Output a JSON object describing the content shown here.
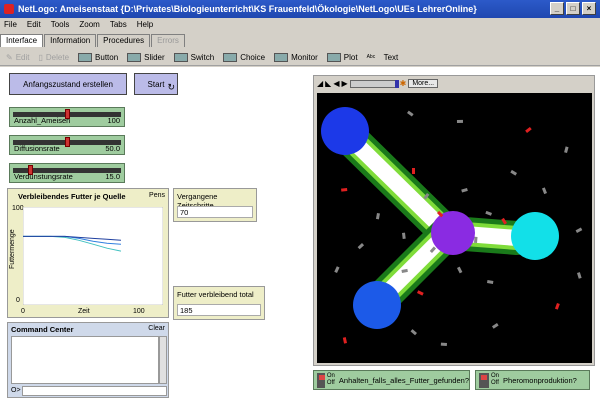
{
  "window": {
    "title": "NetLogo: Ameisenstaat {D:\\Privates\\Biologieunterricht\\KS Frauenfeld\\Ökologie\\NetLogo\\UEs LehrerOnline}"
  },
  "menu": [
    "File",
    "Edit",
    "Tools",
    "Zoom",
    "Tabs",
    "Help"
  ],
  "tabs": [
    "Interface",
    "Information",
    "Procedures",
    "Errors"
  ],
  "toolbar": {
    "edit": "Edit",
    "delete": "Delete",
    "button": "Button",
    "slider": "Slider",
    "switch": "Switch",
    "choice": "Choice",
    "monitor": "Monitor",
    "plot": "Plot",
    "text": "Text",
    "plot_icon": "Plot",
    "text_icon": "Abc def ghi jkl"
  },
  "buttons": {
    "setup": "Anfangszustand erstellen",
    "go": "Start"
  },
  "sliders": [
    {
      "label": "Anzahl_Ameisen",
      "value": "100",
      "fraction": 0.5
    },
    {
      "label": "Diffusionsrate",
      "value": "50.0",
      "fraction": 0.5
    },
    {
      "label": "Verdunstungsrate",
      "value": "15.0",
      "fraction": 0.15
    }
  ],
  "plot": {
    "title": "Verbleibendes Futter je Quelle",
    "pens": "Pens",
    "ylabel": "Futtermenge",
    "xlabel": "Zeit",
    "ymax": "100",
    "ymin": "0",
    "xmin": "0",
    "xmax": "100"
  },
  "monitors": [
    {
      "label": "Vergangene Zeitschritte",
      "value": "70"
    },
    {
      "label": "Futter verbleibend total",
      "value": "185"
    }
  ],
  "command_center": {
    "title": "Command Center",
    "clear": "Clear",
    "prompt": "O>"
  },
  "view_controls": {
    "more": "More..."
  },
  "switches": [
    {
      "label": "Anhalten_falls_alles_Futter_gefunden?",
      "on": "On",
      "off": "Off"
    },
    {
      "label": "Pheromonproduktion?",
      "on": "On",
      "off": "Off"
    }
  ],
  "chart_data": {
    "type": "line",
    "title": "Verbleibendes Futter je Quelle",
    "xlabel": "Zeit",
    "ylabel": "Futtermenge",
    "xlim": [
      0,
      100
    ],
    "ylim": [
      0,
      100
    ],
    "series": [
      {
        "color": "#3080e0",
        "x": [
          0,
          20,
          30,
          40,
          50,
          60,
          70
        ],
        "y": [
          70,
          70,
          70,
          68,
          65,
          63,
          62
        ]
      },
      {
        "color": "#40c0c0",
        "x": [
          0,
          20,
          30,
          40,
          50,
          60,
          70
        ],
        "y": [
          70,
          70,
          69,
          66,
          62,
          58,
          55
        ]
      },
      {
        "color": "#2040a0",
        "x": [
          0,
          20,
          30,
          40,
          50,
          60,
          70
        ],
        "y": [
          70,
          70,
          70,
          69,
          68,
          67,
          66
        ]
      }
    ]
  }
}
